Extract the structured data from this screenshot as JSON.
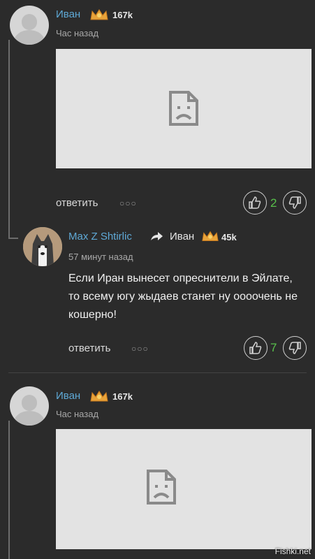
{
  "comments": [
    {
      "author": "Иван",
      "karma": "167k",
      "time": "Час назад",
      "reply_label": "ответить",
      "more_label": "○○○",
      "votes": "2"
    },
    {
      "author": "Max Z Shtirlic",
      "reply_to_author": "Иван",
      "reply_to_karma": "45k",
      "time": "57 минут назад",
      "text": "Если Иран вынесет опреснители в Эйлате, то всему югу жыдаев станет ну оооочень не кошерно!",
      "reply_label": "ответить",
      "more_label": "○○○",
      "votes": "7"
    },
    {
      "author": "Иван",
      "karma": "167k",
      "time": "Час назад"
    }
  ],
  "watermark": "Fishki.net",
  "colors": {
    "background": "#2b2b2b",
    "username": "#5fa9d6",
    "vote_count": "#58c04b"
  },
  "icons": [
    "crown-icon",
    "thumbs-up-icon",
    "thumbs-down-icon",
    "reply-arrow-icon",
    "broken-image-icon"
  ]
}
